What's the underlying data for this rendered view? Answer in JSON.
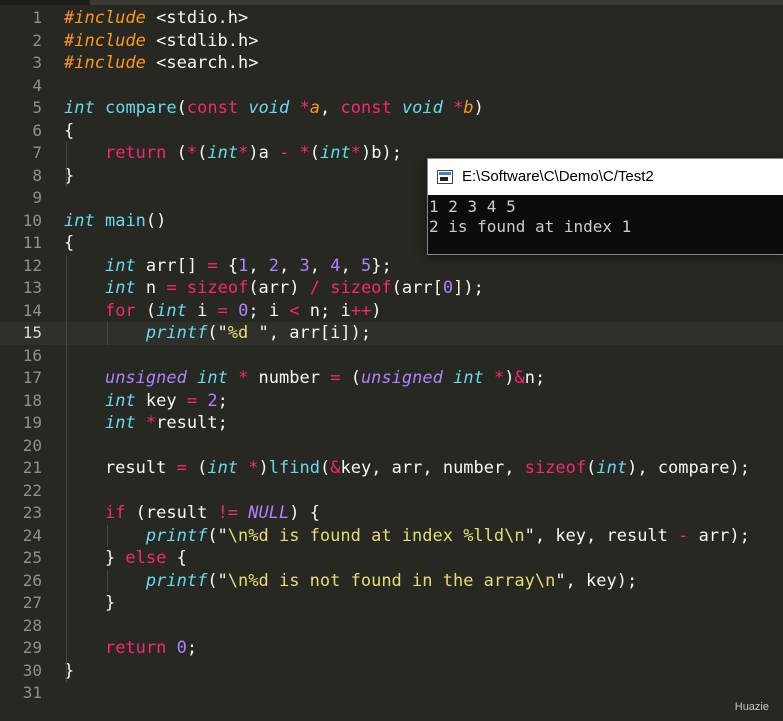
{
  "editor": {
    "current_line": 15,
    "line_numbers": [
      "1",
      "2",
      "3",
      "4",
      "5",
      "6",
      "7",
      "8",
      "9",
      "10",
      "11",
      "12",
      "13",
      "14",
      "15",
      "16",
      "17",
      "18",
      "19",
      "20",
      "21",
      "22",
      "23",
      "24",
      "25",
      "26",
      "27",
      "28",
      "29",
      "30",
      "31"
    ],
    "code_lines": [
      [
        [
          "p",
          "#include "
        ],
        [
          "pl",
          "<stdio.h>"
        ]
      ],
      [
        [
          "p",
          "#include "
        ],
        [
          "pl",
          "<stdlib.h>"
        ]
      ],
      [
        [
          "p",
          "#include "
        ],
        [
          "pl",
          "<search.h>"
        ]
      ],
      [],
      [
        [
          "t",
          "int"
        ],
        [
          "pl",
          " "
        ],
        [
          "f",
          "compare"
        ],
        [
          "pl",
          "("
        ],
        [
          "k",
          "const"
        ],
        [
          "pl",
          " "
        ],
        [
          "t",
          "void"
        ],
        [
          "pl",
          " "
        ],
        [
          "o",
          "*"
        ],
        [
          "p",
          "a"
        ],
        [
          "pl",
          ", "
        ],
        [
          "k",
          "const"
        ],
        [
          "pl",
          " "
        ],
        [
          "t",
          "void"
        ],
        [
          "pl",
          " "
        ],
        [
          "o",
          "*"
        ],
        [
          "p",
          "b"
        ],
        [
          "pl",
          ")"
        ]
      ],
      [
        [
          "pl",
          "{"
        ]
      ],
      [
        [
          "pl",
          "    "
        ],
        [
          "k",
          "return"
        ],
        [
          "pl",
          " ("
        ],
        [
          "o",
          "*"
        ],
        [
          "pl",
          "("
        ],
        [
          "t",
          "int"
        ],
        [
          "o",
          "*"
        ],
        [
          "pl",
          ")a "
        ],
        [
          "o",
          "-"
        ],
        [
          "pl",
          " "
        ],
        [
          "o",
          "*"
        ],
        [
          "pl",
          "("
        ],
        [
          "t",
          "int"
        ],
        [
          "o",
          "*"
        ],
        [
          "pl",
          ")b);"
        ]
      ],
      [
        [
          "pl",
          "}"
        ]
      ],
      [],
      [
        [
          "t",
          "int"
        ],
        [
          "pl",
          " "
        ],
        [
          "f",
          "main"
        ],
        [
          "pl",
          "()"
        ]
      ],
      [
        [
          "pl",
          "{"
        ]
      ],
      [
        [
          "pl",
          "    "
        ],
        [
          "t",
          "int"
        ],
        [
          "pl",
          " arr[] "
        ],
        [
          "o",
          "="
        ],
        [
          "pl",
          " {"
        ],
        [
          "n",
          "1"
        ],
        [
          "pl",
          ", "
        ],
        [
          "n",
          "2"
        ],
        [
          "pl",
          ", "
        ],
        [
          "n",
          "3"
        ],
        [
          "pl",
          ", "
        ],
        [
          "n",
          "4"
        ],
        [
          "pl",
          ", "
        ],
        [
          "n",
          "5"
        ],
        [
          "pl",
          "};"
        ]
      ],
      [
        [
          "pl",
          "    "
        ],
        [
          "t",
          "int"
        ],
        [
          "pl",
          " n "
        ],
        [
          "o",
          "="
        ],
        [
          "pl",
          " "
        ],
        [
          "k",
          "sizeof"
        ],
        [
          "pl",
          "(arr) "
        ],
        [
          "o",
          "/"
        ],
        [
          "pl",
          " "
        ],
        [
          "k",
          "sizeof"
        ],
        [
          "pl",
          "(arr["
        ],
        [
          "n",
          "0"
        ],
        [
          "pl",
          "]);"
        ]
      ],
      [
        [
          "pl",
          "    "
        ],
        [
          "k",
          "for"
        ],
        [
          "pl",
          " ("
        ],
        [
          "t",
          "int"
        ],
        [
          "pl",
          " i "
        ],
        [
          "o",
          "="
        ],
        [
          "pl",
          " "
        ],
        [
          "n",
          "0"
        ],
        [
          "pl",
          "; i "
        ],
        [
          "o",
          "<"
        ],
        [
          "pl",
          " n; i"
        ],
        [
          "o",
          "++"
        ],
        [
          "pl",
          ")"
        ]
      ],
      [
        [
          "pl",
          "        "
        ],
        [
          "t",
          "printf"
        ],
        [
          "pl",
          "(\""
        ],
        [
          "s",
          "%d "
        ],
        [
          "pl",
          "\", arr[i]);"
        ]
      ],
      [],
      [
        [
          "pl",
          "    "
        ],
        [
          "c",
          "unsigned"
        ],
        [
          "pl",
          " "
        ],
        [
          "t",
          "int"
        ],
        [
          "pl",
          " "
        ],
        [
          "o",
          "*"
        ],
        [
          "pl",
          " number "
        ],
        [
          "o",
          "="
        ],
        [
          "pl",
          " ("
        ],
        [
          "c",
          "unsigned"
        ],
        [
          "pl",
          " "
        ],
        [
          "t",
          "int"
        ],
        [
          "pl",
          " "
        ],
        [
          "o",
          "*"
        ],
        [
          "pl",
          ")"
        ],
        [
          "o",
          "&"
        ],
        [
          "pl",
          "n;"
        ]
      ],
      [
        [
          "pl",
          "    "
        ],
        [
          "t",
          "int"
        ],
        [
          "pl",
          " key "
        ],
        [
          "o",
          "="
        ],
        [
          "pl",
          " "
        ],
        [
          "n",
          "2"
        ],
        [
          "pl",
          ";"
        ]
      ],
      [
        [
          "pl",
          "    "
        ],
        [
          "t",
          "int"
        ],
        [
          "pl",
          " "
        ],
        [
          "o",
          "*"
        ],
        [
          "pl",
          "result;"
        ]
      ],
      [],
      [
        [
          "pl",
          "    result "
        ],
        [
          "o",
          "="
        ],
        [
          "pl",
          " ("
        ],
        [
          "t",
          "int"
        ],
        [
          "pl",
          " "
        ],
        [
          "o",
          "*"
        ],
        [
          "pl",
          ")"
        ],
        [
          "f",
          "lfind"
        ],
        [
          "pl",
          "("
        ],
        [
          "o",
          "&"
        ],
        [
          "pl",
          "key, arr, number, "
        ],
        [
          "k",
          "sizeof"
        ],
        [
          "pl",
          "("
        ],
        [
          "t",
          "int"
        ],
        [
          "pl",
          "), compare);"
        ]
      ],
      [],
      [
        [
          "pl",
          "    "
        ],
        [
          "k",
          "if"
        ],
        [
          "pl",
          " (result "
        ],
        [
          "o",
          "!="
        ],
        [
          "pl",
          " "
        ],
        [
          "c",
          "NULL"
        ],
        [
          "pl",
          ") {"
        ]
      ],
      [
        [
          "pl",
          "        "
        ],
        [
          "t",
          "printf"
        ],
        [
          "pl",
          "(\""
        ],
        [
          "s",
          "\\n%d is found at index %lld\\n"
        ],
        [
          "pl",
          "\", key, result "
        ],
        [
          "o",
          "-"
        ],
        [
          "pl",
          " arr);"
        ]
      ],
      [
        [
          "pl",
          "    } "
        ],
        [
          "k",
          "else"
        ],
        [
          "pl",
          " {"
        ]
      ],
      [
        [
          "pl",
          "        "
        ],
        [
          "t",
          "printf"
        ],
        [
          "pl",
          "(\""
        ],
        [
          "s",
          "\\n%d is not found in the array\\n"
        ],
        [
          "pl",
          "\", key);"
        ]
      ],
      [
        [
          "pl",
          "    }"
        ]
      ],
      [],
      [
        [
          "pl",
          "    "
        ],
        [
          "k",
          "return"
        ],
        [
          "pl",
          " "
        ],
        [
          "n",
          "0"
        ],
        [
          "pl",
          ";"
        ]
      ],
      [
        [
          "pl",
          "}"
        ]
      ],
      []
    ]
  },
  "console": {
    "title": "E:\\Software\\C\\Demo\\C/Test2",
    "output_lines": [
      "1 2 3 4 5",
      "2 is found at index 1"
    ]
  },
  "watermark": "Huazie",
  "colors": {
    "background": "#272822",
    "keyword": "#f92672",
    "type": "#66d9ef",
    "number": "#ae81ff",
    "string": "#e6db74",
    "param": "#fd971f",
    "console_bg": "#0c0c0c"
  }
}
